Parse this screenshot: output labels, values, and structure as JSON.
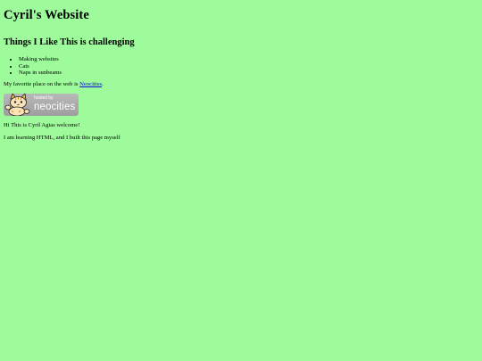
{
  "header": {
    "title": "Cyril's Website"
  },
  "likes": {
    "heading": "Things I Like This is challenging",
    "items": [
      "Making websites",
      "Cats",
      "Naps in sunbeams"
    ]
  },
  "favorite": {
    "prefix": "My favorite place on the web is ",
    "link_text": "Neocities",
    "suffix": "."
  },
  "badge": {
    "small_text": "hosted by",
    "big_text": "neocities",
    "icon": "cat-icon"
  },
  "paragraphs": {
    "welcome": "Hi This is Cyril Agias welcome!",
    "learning": "I am learning HTML, and I built this page myself"
  },
  "colors": {
    "background": "#9dfb9b",
    "link": "#0000ee",
    "badge": "#a8a8a8"
  }
}
